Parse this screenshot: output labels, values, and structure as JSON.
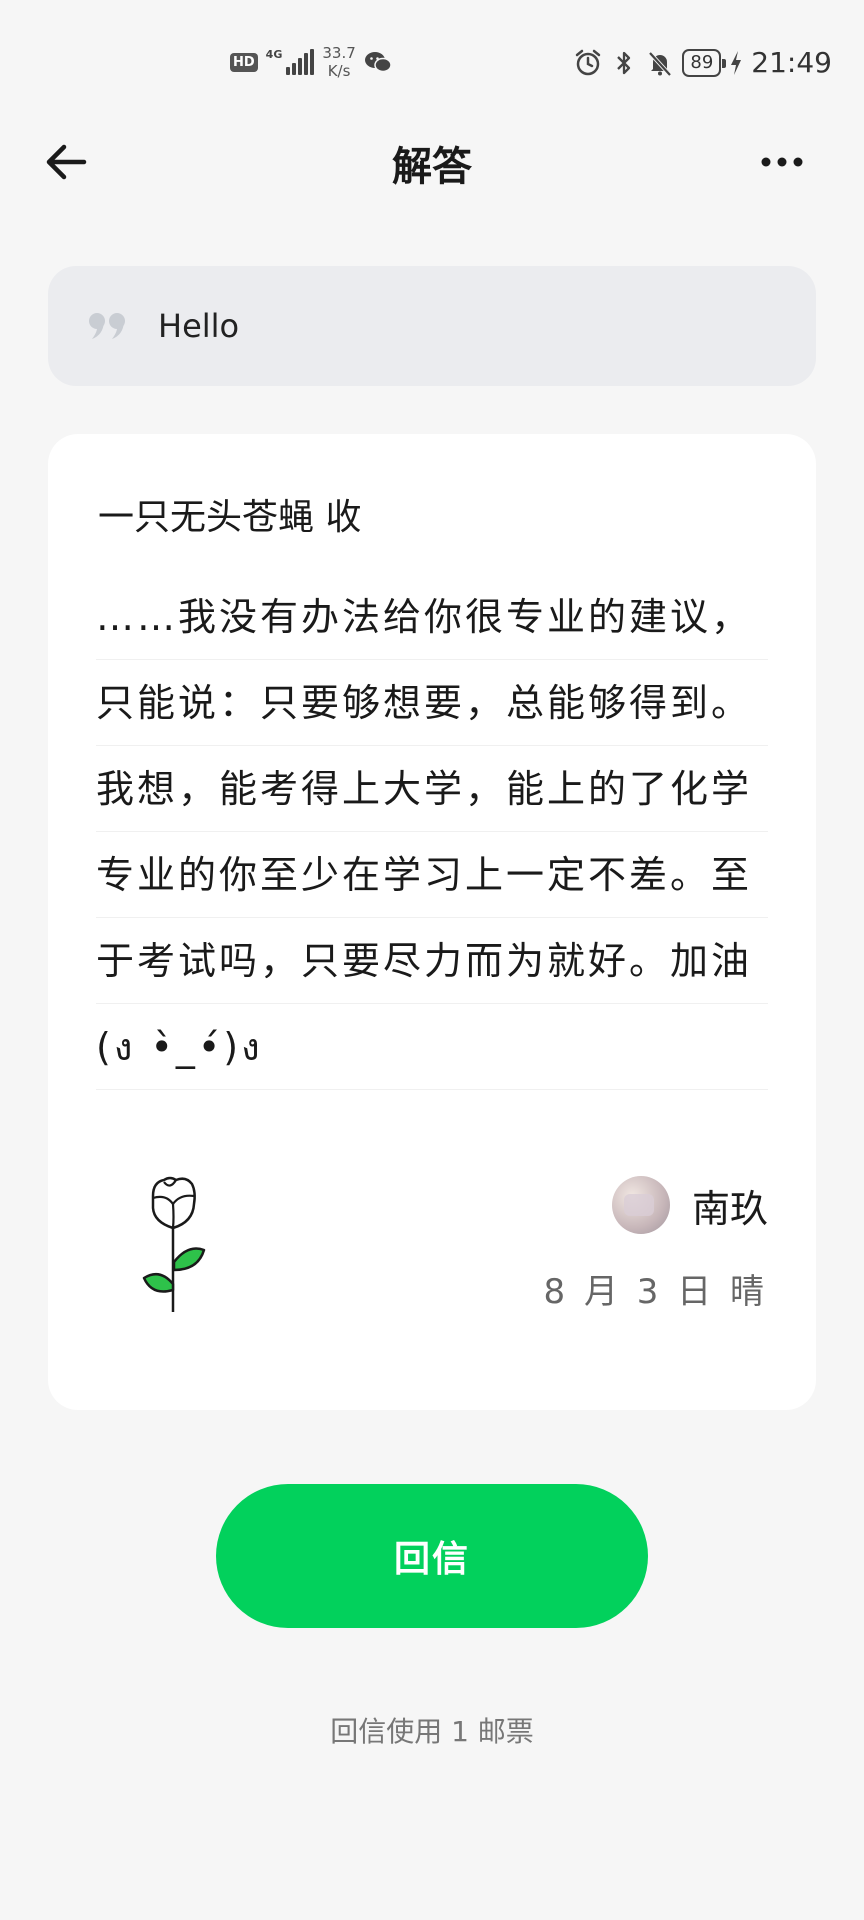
{
  "status_bar": {
    "hd_badge": "HD",
    "network": "4G",
    "speed_value": "33.7",
    "speed_unit": "K/s",
    "battery": "89",
    "time": "21:49"
  },
  "header": {
    "title": "解答",
    "back_icon": "arrow-left-icon",
    "more_icon": "more-dots-icon"
  },
  "question": {
    "text": "Hello",
    "icon": "quote-icon"
  },
  "answer": {
    "author_line": "一只无头苍蝇 收",
    "lines": [
      "……我没有办法给你很专业的建议，",
      "只能说：只要够想要，总能够得到。",
      "我想，能考得上大学，能上的了化学",
      "专业的你至少在学习上一定不差。至",
      "于考试吗，只要尽力而为就好。加油",
      "(ง •̀_•́)ง"
    ],
    "signer_name": "南玖",
    "date": "8 月 3 日 晴"
  },
  "reply": {
    "button_label": "回信",
    "note": "回信使用 1 邮票"
  },
  "colors": {
    "accent": "#02d15c",
    "background": "#f6f6f6",
    "question_bg": "#ebecef",
    "rose_leaf": "#2ec24a"
  }
}
